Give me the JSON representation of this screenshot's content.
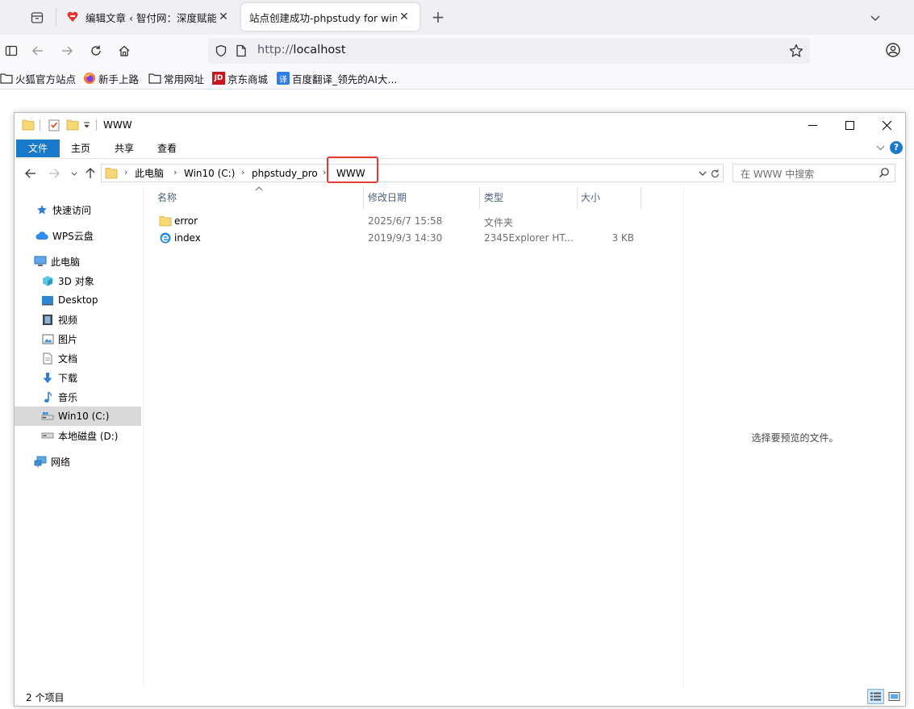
{
  "browser": {
    "tabs": [
      {
        "title": "编辑文章 ‹ 智付网：深度赋能，",
        "active": false
      },
      {
        "title": "站点创建成功-phpstudy for windo",
        "active": true
      }
    ],
    "url_prefix": "http://",
    "url_host": "localhost",
    "bookmarks": [
      {
        "label": "火狐官方站点",
        "icon": "folder-icon"
      },
      {
        "label": "新手上路",
        "icon": "firefox-icon"
      },
      {
        "label": "常用网址",
        "icon": "folder-icon"
      },
      {
        "label": "京东商城",
        "icon": "jd-icon",
        "badge": "JD"
      },
      {
        "label": "百度翻译_领先的AI大...",
        "icon": "baidu-translate-icon",
        "badge": "译"
      }
    ]
  },
  "explorer": {
    "title": "WWW",
    "ribbon_tabs": [
      "文件",
      "主页",
      "共享",
      "查看"
    ],
    "breadcrumb": [
      "此电脑",
      "Win10 (C:)",
      "phpstudy_pro",
      "WWW"
    ],
    "search_placeholder": "在 WWW 中搜索",
    "nav": [
      {
        "label": "快速访问",
        "icon": "star-icon"
      },
      {
        "label": "WPS云盘",
        "icon": "cloud-icon"
      },
      {
        "label": "此电脑",
        "icon": "computer-icon"
      },
      {
        "label": "3D 对象",
        "icon": "cube-icon"
      },
      {
        "label": "Desktop",
        "icon": "desktop-icon"
      },
      {
        "label": "视频",
        "icon": "video-icon"
      },
      {
        "label": "图片",
        "icon": "picture-icon"
      },
      {
        "label": "文档",
        "icon": "document-icon"
      },
      {
        "label": "下载",
        "icon": "download-icon"
      },
      {
        "label": "音乐",
        "icon": "music-icon"
      },
      {
        "label": "Win10 (C:)",
        "icon": "drive-c-icon",
        "selected": true
      },
      {
        "label": "本地磁盘 (D:)",
        "icon": "drive-d-icon"
      },
      {
        "label": "网络",
        "icon": "network-icon"
      }
    ],
    "columns": [
      "名称",
      "修改日期",
      "类型",
      "大小"
    ],
    "files": [
      {
        "name": "error",
        "date": "2025/6/7 15:58",
        "type": "文件夹",
        "size": "",
        "icon": "folder-icon"
      },
      {
        "name": "index",
        "date": "2019/9/3 14:30",
        "type": "2345Explorer HT...",
        "size": "3 KB",
        "icon": "html-file-icon"
      }
    ],
    "preview_message": "选择要预览的文件。",
    "status": "2 个项目",
    "colors": {
      "accent": "#1979ca",
      "highlight_box": "#e53935",
      "selected_nav": "#d9d9d9"
    }
  }
}
